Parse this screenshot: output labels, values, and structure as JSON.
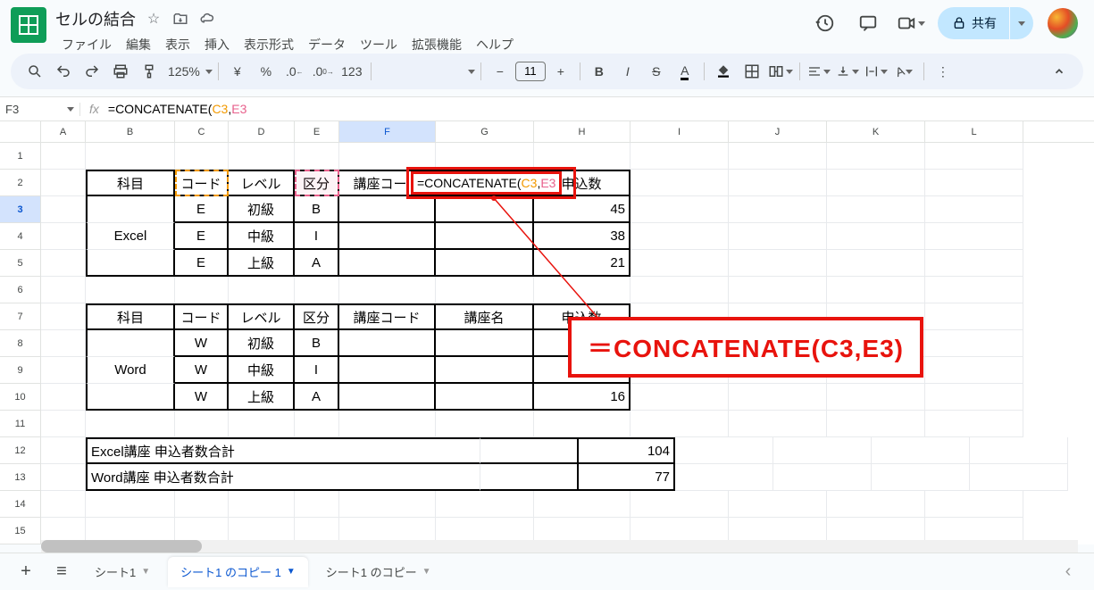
{
  "doc": {
    "title": "セルの結合"
  },
  "menu": {
    "file": "ファイル",
    "edit": "編集",
    "view": "表示",
    "insert": "挿入",
    "format": "表示形式",
    "data": "データ",
    "tools": "ツール",
    "extensions": "拡張機能",
    "help": "ヘルプ"
  },
  "toolbar": {
    "zoom": "125%",
    "currency": "¥",
    "percent": "%",
    "dec_dec": ".0",
    "dec_inc": ".00",
    "numfmt": "123",
    "fontsize": "11"
  },
  "share": {
    "label": "共有"
  },
  "namebox": "F3",
  "formula": {
    "prefix": "=CONCATENATE(",
    "ref1": "C3",
    "comma": ",",
    "ref2": "E3"
  },
  "columns": [
    "A",
    "B",
    "C",
    "D",
    "E",
    "F",
    "G",
    "H",
    "I",
    "J",
    "K",
    "L"
  ],
  "rows": [
    "1",
    "2",
    "3",
    "4",
    "5",
    "6",
    "7",
    "8",
    "9",
    "10",
    "11",
    "12",
    "13",
    "14",
    "15"
  ],
  "headers": {
    "subject": "科目",
    "code": "コード",
    "level": "レベル",
    "kubun": "区分",
    "coursecode": "講座コード",
    "coursename": "講座名",
    "apply": "申込数"
  },
  "table1": {
    "subject": "Excel",
    "rows": [
      {
        "code": "E",
        "level": "初級",
        "kubun": "B",
        "apply": "45"
      },
      {
        "code": "E",
        "level": "中級",
        "kubun": "I",
        "apply": "38"
      },
      {
        "code": "E",
        "level": "上級",
        "kubun": "A",
        "apply": "21"
      }
    ]
  },
  "table2": {
    "subject": "Word",
    "rows": [
      {
        "code": "W",
        "level": "初級",
        "kubun": "B",
        "apply": ""
      },
      {
        "code": "W",
        "level": "中級",
        "kubun": "I",
        "apply": ""
      },
      {
        "code": "W",
        "level": "上級",
        "kubun": "A",
        "apply": "16"
      }
    ]
  },
  "totals": {
    "excel_label": "Excel講座 申込者数合計",
    "excel_val": "104",
    "word_label": "Word講座 申込者数合計",
    "word_val": "77"
  },
  "editing": {
    "prefix": "=CONCATENATE(",
    "ref1": "C3",
    "comma": ",",
    "ref2": "E3"
  },
  "callout": "＝CONCATENATE(C3,E3)",
  "tabs": {
    "t1": "シート1",
    "t2": "シート1 のコピー 1",
    "t3": "シート1 のコピー"
  }
}
